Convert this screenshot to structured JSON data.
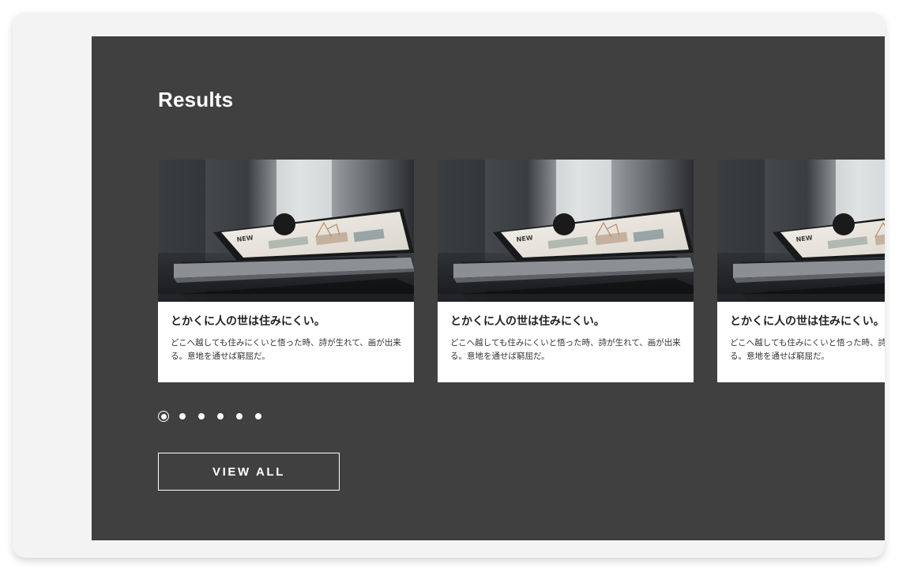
{
  "section": {
    "title": "Results"
  },
  "cards": [
    {
      "image": "laptop-photo",
      "title": "とかくに人の世は住みにくい。",
      "text": "どこへ越しても住みにくいと悟った時、詩が生れて、画が出来る。意地を通せば窮屈だ。"
    },
    {
      "image": "laptop-photo",
      "title": "とかくに人の世は住みにくい。",
      "text": "どこへ越しても住みにくいと悟った時、詩が生れて、画が出来る。意地を通せば窮屈だ。"
    },
    {
      "image": "laptop-photo",
      "title": "とかくに人の世は住みにくい。",
      "text": "どこへ越しても住みにくいと悟った時、詩が生れて、画が出来る。意地を通せば窮屈だ。"
    }
  ],
  "pagination": {
    "count": 6,
    "active_index": 0
  },
  "view_all_label": "VIEW ALL",
  "colors": {
    "section_background": "#404040",
    "frame_background": "#f3f3f3",
    "card_background": "#ffffff",
    "accent": "#ffffff"
  }
}
